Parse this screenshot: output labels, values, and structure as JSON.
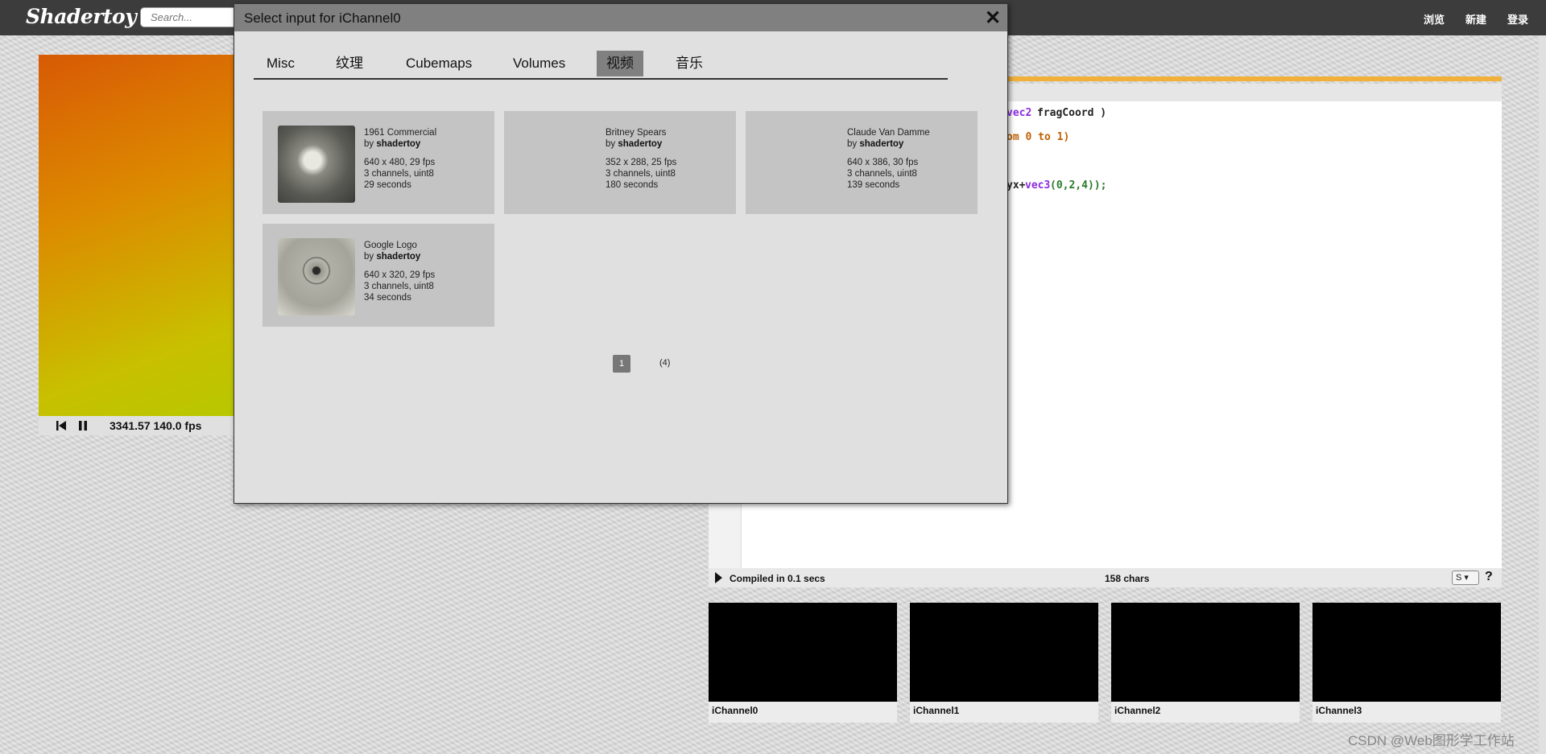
{
  "topbar": {
    "logo": "Shadertoy",
    "search_placeholder": "Search...",
    "nav": [
      "浏览",
      "新建",
      "登录"
    ]
  },
  "player": {
    "time": "3341.57",
    "fps": "140.0 fps"
  },
  "editor": {
    "code_fragments": [
      {
        "text": "vec2",
        "color": "#8a2be2"
      },
      {
        "text": "fragCoord )",
        "color": "#222222"
      },
      {
        "text": "om 0 to 1)",
        "color": "#c06000"
      },
      {
        "text": "yx+",
        "color": "#222222"
      },
      {
        "text": "vec3",
        "color": "#8a2be2"
      },
      {
        "text": "(0,2,4));",
        "color": "#2a7a2a"
      }
    ],
    "compile_status": "Compiled in 0.1 secs",
    "char_count": "158 chars",
    "font_size_select": "S",
    "help": "?"
  },
  "channels": [
    "iChannel0",
    "iChannel1",
    "iChannel2",
    "iChannel3"
  ],
  "dialog": {
    "title": "Select input for iChannel0",
    "close": "✕",
    "tabs": [
      "Misc",
      "纹理",
      "Cubemaps",
      "Volumes",
      "视频",
      "音乐"
    ],
    "active_tab": "视频",
    "assets": [
      {
        "name": "1961 Commercial",
        "by": "by",
        "author": "shadertoy",
        "resolution": "640 x 480, 29 fps",
        "channels": "3 channels, uint8",
        "duration": "29 seconds",
        "has_preview": true
      },
      {
        "name": "Britney Spears",
        "by": "by",
        "author": "shadertoy",
        "resolution": "352 x 288, 25 fps",
        "channels": "3 channels, uint8",
        "duration": "180 seconds",
        "has_preview": false
      },
      {
        "name": "Claude Van Damme",
        "by": "by",
        "author": "shadertoy",
        "resolution": "640 x 386, 30 fps",
        "channels": "3 channels, uint8",
        "duration": "139 seconds",
        "has_preview": false
      },
      {
        "name": "Google Logo",
        "by": "by",
        "author": "shadertoy",
        "resolution": "640 x 320, 29 fps",
        "channels": "3 channels, uint8",
        "duration": "34 seconds",
        "has_preview": true
      }
    ],
    "pagination": {
      "current": "1",
      "total": "(4)"
    }
  },
  "watermark": "CSDN @Web图形学工作站",
  "colors": {
    "topbar": "#3c3c3c",
    "editor_accent": "#f0b03a",
    "active_tab": "#808080"
  }
}
